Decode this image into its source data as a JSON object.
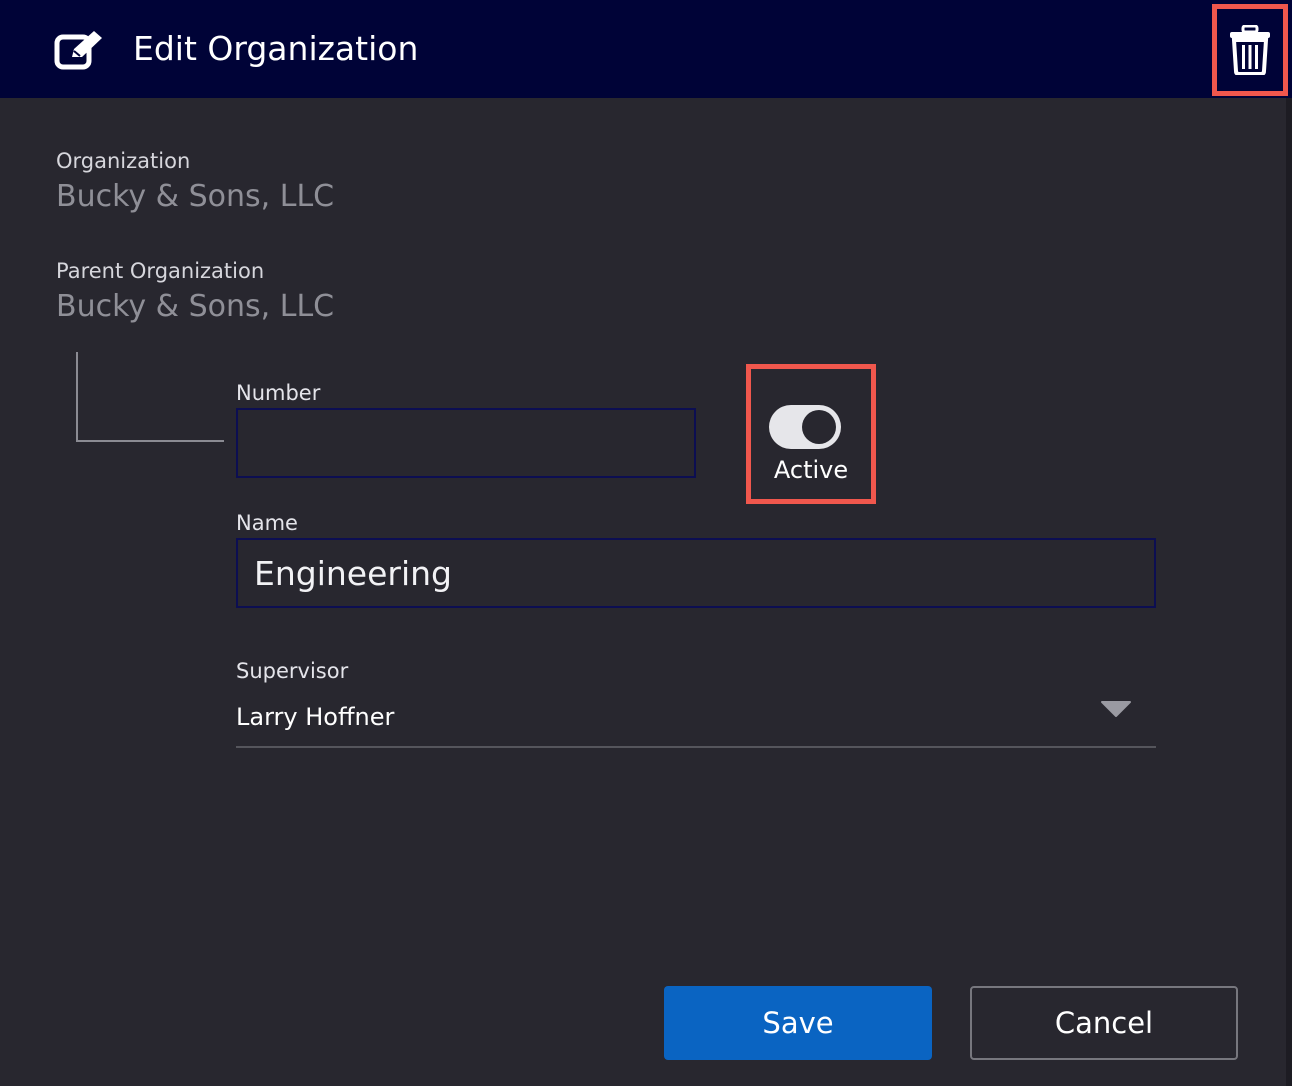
{
  "header": {
    "title": "Edit Organization",
    "edit_icon": "edit-square-icon",
    "delete_icon": "trash-icon"
  },
  "organization": {
    "label": "Organization",
    "value": "Bucky & Sons, LLC"
  },
  "parent_organization": {
    "label": "Parent Organization",
    "value": "Bucky & Sons, LLC"
  },
  "number": {
    "label": "Number",
    "value": "",
    "placeholder": ""
  },
  "active_toggle": {
    "label": "Active",
    "on": true
  },
  "name": {
    "label": "Name",
    "value": "Engineering"
  },
  "supervisor": {
    "label": "Supervisor",
    "selected": "Larry Hoffner"
  },
  "actions": {
    "save_label": "Save",
    "cancel_label": "Cancel"
  },
  "colors": {
    "header_bg": "#000337",
    "dialog_bg": "#28272f",
    "highlight": "#f0574d",
    "primary_button": "#0a64c2"
  }
}
